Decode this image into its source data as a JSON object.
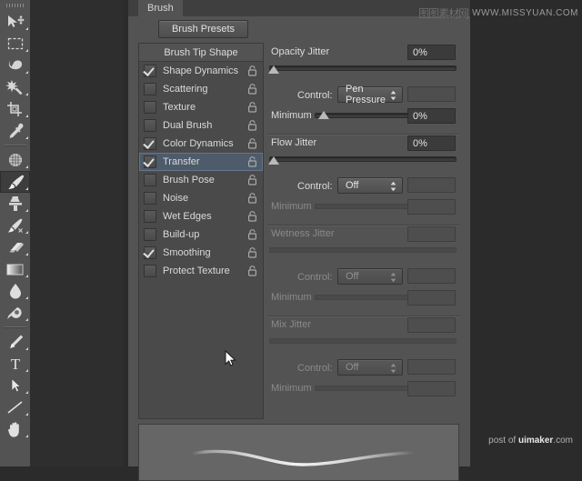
{
  "app": {
    "tab_label": "Brush",
    "presets_button": "Brush Presets"
  },
  "toolbar": {
    "tools": [
      {
        "name": "move-tool",
        "icon": "move-arrow-icon",
        "selected": false
      },
      {
        "name": "rectangular-marquee-tool",
        "icon": "marquee-icon",
        "selected": false
      },
      {
        "name": "lasso-tool",
        "icon": "lasso-icon",
        "selected": false
      },
      {
        "name": "quick-selection-tool",
        "icon": "magic-wand-icon",
        "selected": false
      },
      {
        "name": "crop-tool",
        "icon": "crop-icon",
        "selected": false
      },
      {
        "name": "eyedropper-tool",
        "icon": "eyedropper-icon",
        "selected": false
      },
      {
        "name": "spot-healing-brush-tool",
        "icon": "healing-icon",
        "selected": false
      },
      {
        "name": "brush-tool",
        "icon": "brush-icon",
        "selected": true
      },
      {
        "name": "clone-stamp-tool",
        "icon": "stamp-icon",
        "selected": false
      },
      {
        "name": "history-brush-tool",
        "icon": "history-brush-icon",
        "selected": false
      },
      {
        "name": "eraser-tool",
        "icon": "eraser-icon",
        "selected": false
      },
      {
        "name": "gradient-tool",
        "icon": "gradient-icon",
        "selected": false
      },
      {
        "name": "blur-tool",
        "icon": "blur-drop-icon",
        "selected": false
      },
      {
        "name": "dodge-tool",
        "icon": "dodge-icon",
        "selected": false
      },
      {
        "name": "pen-tool",
        "icon": "pen-icon",
        "selected": false
      },
      {
        "name": "type-tool",
        "icon": "type-t-icon",
        "selected": false
      },
      {
        "name": "path-selection-tool",
        "icon": "path-arrow-icon",
        "selected": false
      },
      {
        "name": "line-tool",
        "icon": "line-icon",
        "selected": false
      },
      {
        "name": "hand-tool",
        "icon": "hand-icon",
        "selected": false
      }
    ]
  },
  "brush_list": {
    "header": "Brush Tip Shape",
    "items": [
      {
        "label": "Shape Dynamics",
        "checked": true,
        "active": false,
        "locked": false
      },
      {
        "label": "Scattering",
        "checked": false,
        "active": false,
        "locked": false
      },
      {
        "label": "Texture",
        "checked": false,
        "active": false,
        "locked": false
      },
      {
        "label": "Dual Brush",
        "checked": false,
        "active": false,
        "locked": false
      },
      {
        "label": "Color Dynamics",
        "checked": true,
        "active": false,
        "locked": false
      },
      {
        "label": "Transfer",
        "checked": true,
        "active": true,
        "locked": false
      },
      {
        "label": "Brush Pose",
        "checked": false,
        "active": false,
        "locked": false
      },
      {
        "label": "Noise",
        "checked": false,
        "active": false,
        "locked": false
      },
      {
        "label": "Wet Edges",
        "checked": false,
        "active": false,
        "locked": false
      },
      {
        "label": "Build-up",
        "checked": false,
        "active": false,
        "locked": false
      },
      {
        "label": "Smoothing",
        "checked": true,
        "active": false,
        "locked": false
      },
      {
        "label": "Protect Texture",
        "checked": false,
        "active": false,
        "locked": false
      }
    ]
  },
  "settings": {
    "control_label": "Control:",
    "minimum_label": "Minimum",
    "sections": [
      {
        "title": "Opacity Jitter",
        "value": "0%",
        "slider_percent": 0,
        "enabled": true,
        "control_value": "Pen Pressure",
        "control_extra": "",
        "minimum_value": "0%",
        "minimum_percent": 4,
        "minimum_enabled": true
      },
      {
        "title": "Flow Jitter",
        "value": "0%",
        "slider_percent": 0,
        "enabled": true,
        "control_value": "Off",
        "control_extra": "",
        "minimum_value": "",
        "minimum_percent": 0,
        "minimum_enabled": false
      },
      {
        "title": "Wetness Jitter",
        "value": "",
        "slider_percent": 0,
        "enabled": false,
        "control_value": "Off",
        "control_extra": "",
        "minimum_value": "",
        "minimum_percent": 0,
        "minimum_enabled": false
      },
      {
        "title": "Mix Jitter",
        "value": "",
        "slider_percent": 0,
        "enabled": false,
        "control_value": "Off",
        "control_extra": "",
        "minimum_value": "",
        "minimum_percent": 0,
        "minimum_enabled": false
      }
    ]
  },
  "preview": {
    "name": "brush-stroke-preview"
  },
  "watermarks": {
    "top_cjk": "图图素材网",
    "top_url": "WWW.MISSYUAN.COM",
    "bottom_prefix": "post of ",
    "bottom_brand": "uimaker",
    "bottom_suffix": ".com"
  },
  "colors": {
    "panel_bg": "#535353",
    "list_bg": "#4a4a4a",
    "active_row": "#4d5b6b",
    "text": "#dadada",
    "dim_text": "#8a8a8a",
    "value_bg": "#3b3b3b"
  }
}
